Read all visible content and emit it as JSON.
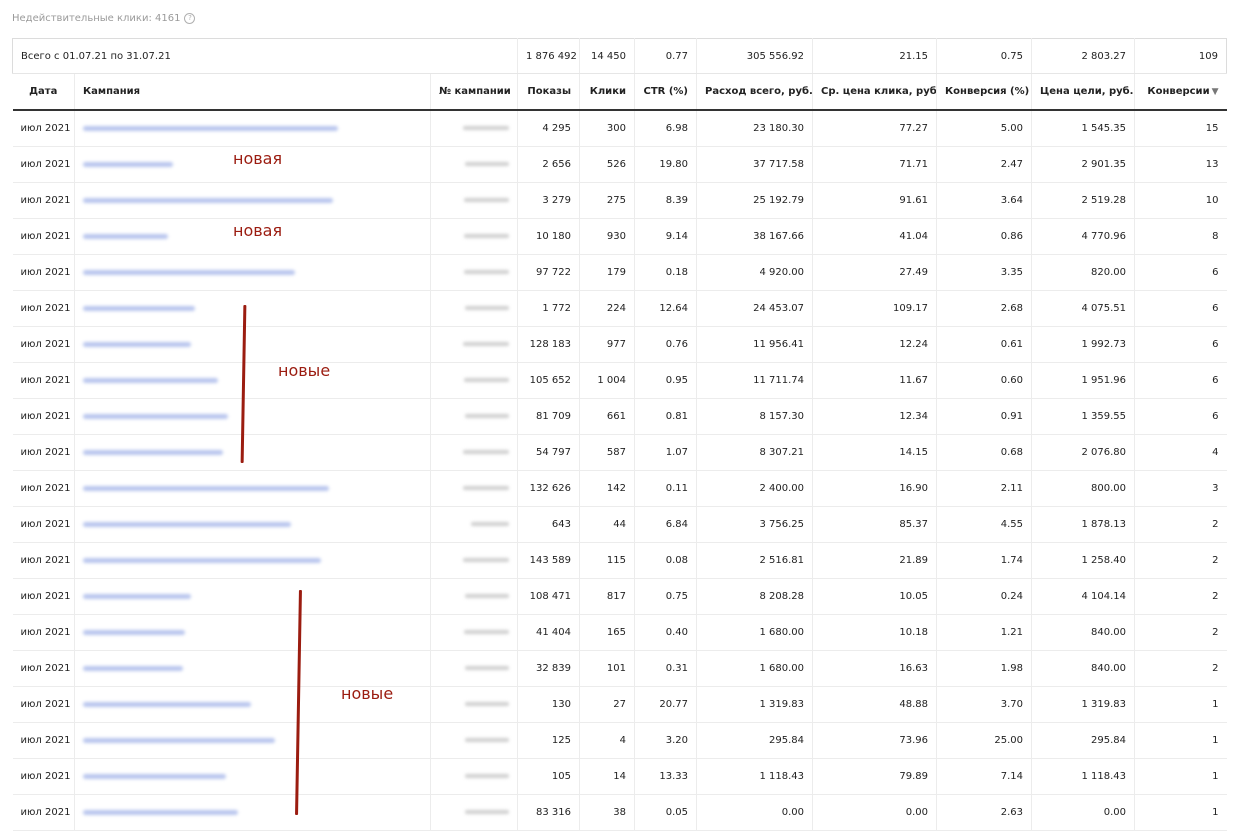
{
  "header": {
    "invalid_clicks": "Недействительные клики: 4161",
    "help_glyph": "?"
  },
  "totals": {
    "period": "Всего с 01.07.21 по 31.07.21",
    "impressions": "1 876 492",
    "clicks": "14 450",
    "ctr": "0.77",
    "spend": "305 556.92",
    "avg_cpc": "21.15",
    "conv_rate": "0.75",
    "goal_cost": "2 803.27",
    "conversions": "109"
  },
  "columns": {
    "date": "Дата",
    "campaign": "Кампания",
    "campaign_no": "№ кампании",
    "impressions": "Показы",
    "clicks": "Клики",
    "ctr": "CTR (%)",
    "spend": "Расход всего, руб.",
    "avg_cpc": "Ср. цена клика, руб.",
    "conv_rate": "Конверсия (%)",
    "goal_cost": "Цена цели, руб.",
    "conversions": "Конверсии",
    "sort_glyph": "▼"
  },
  "rows": [
    {
      "date": "июл 2021",
      "imp": "4 295",
      "clk": "300",
      "ctr": "6.98",
      "spend": "23 180.30",
      "cpc": "77.27",
      "cr": "5.00",
      "goal": "1 545.35",
      "conv": "15"
    },
    {
      "date": "июл 2021",
      "imp": "2 656",
      "clk": "526",
      "ctr": "19.80",
      "spend": "37 717.58",
      "cpc": "71.71",
      "cr": "2.47",
      "goal": "2 901.35",
      "conv": "13"
    },
    {
      "date": "июл 2021",
      "imp": "3 279",
      "clk": "275",
      "ctr": "8.39",
      "spend": "25 192.79",
      "cpc": "91.61",
      "cr": "3.64",
      "goal": "2 519.28",
      "conv": "10"
    },
    {
      "date": "июл 2021",
      "imp": "10 180",
      "clk": "930",
      "ctr": "9.14",
      "spend": "38 167.66",
      "cpc": "41.04",
      "cr": "0.86",
      "goal": "4 770.96",
      "conv": "8"
    },
    {
      "date": "июл 2021",
      "imp": "97 722",
      "clk": "179",
      "ctr": "0.18",
      "spend": "4 920.00",
      "cpc": "27.49",
      "cr": "3.35",
      "goal": "820.00",
      "conv": "6"
    },
    {
      "date": "июл 2021",
      "imp": "1 772",
      "clk": "224",
      "ctr": "12.64",
      "spend": "24 453.07",
      "cpc": "109.17",
      "cr": "2.68",
      "goal": "4 075.51",
      "conv": "6"
    },
    {
      "date": "июл 2021",
      "imp": "128 183",
      "clk": "977",
      "ctr": "0.76",
      "spend": "11 956.41",
      "cpc": "12.24",
      "cr": "0.61",
      "goal": "1 992.73",
      "conv": "6"
    },
    {
      "date": "июл 2021",
      "imp": "105 652",
      "clk": "1 004",
      "ctr": "0.95",
      "spend": "11 711.74",
      "cpc": "11.67",
      "cr": "0.60",
      "goal": "1 951.96",
      "conv": "6"
    },
    {
      "date": "июл 2021",
      "imp": "81 709",
      "clk": "661",
      "ctr": "0.81",
      "spend": "8 157.30",
      "cpc": "12.34",
      "cr": "0.91",
      "goal": "1 359.55",
      "conv": "6"
    },
    {
      "date": "июл 2021",
      "imp": "54 797",
      "clk": "587",
      "ctr": "1.07",
      "spend": "8 307.21",
      "cpc": "14.15",
      "cr": "0.68",
      "goal": "2 076.80",
      "conv": "4"
    },
    {
      "date": "июл 2021",
      "imp": "132 626",
      "clk": "142",
      "ctr": "0.11",
      "spend": "2 400.00",
      "cpc": "16.90",
      "cr": "2.11",
      "goal": "800.00",
      "conv": "3"
    },
    {
      "date": "июл 2021",
      "imp": "643",
      "clk": "44",
      "ctr": "6.84",
      "spend": "3 756.25",
      "cpc": "85.37",
      "cr": "4.55",
      "goal": "1 878.13",
      "conv": "2"
    },
    {
      "date": "июл 2021",
      "imp": "143 589",
      "clk": "115",
      "ctr": "0.08",
      "spend": "2 516.81",
      "cpc": "21.89",
      "cr": "1.74",
      "goal": "1 258.40",
      "conv": "2"
    },
    {
      "date": "июл 2021",
      "imp": "108 471",
      "clk": "817",
      "ctr": "0.75",
      "spend": "8 208.28",
      "cpc": "10.05",
      "cr": "0.24",
      "goal": "4 104.14",
      "conv": "2"
    },
    {
      "date": "июл 2021",
      "imp": "41 404",
      "clk": "165",
      "ctr": "0.40",
      "spend": "1 680.00",
      "cpc": "10.18",
      "cr": "1.21",
      "goal": "840.00",
      "conv": "2"
    },
    {
      "date": "июл 2021",
      "imp": "32 839",
      "clk": "101",
      "ctr": "0.31",
      "spend": "1 680.00",
      "cpc": "16.63",
      "cr": "1.98",
      "goal": "840.00",
      "conv": "2"
    },
    {
      "date": "июл 2021",
      "imp": "130",
      "clk": "27",
      "ctr": "20.77",
      "spend": "1 319.83",
      "cpc": "48.88",
      "cr": "3.70",
      "goal": "1 319.83",
      "conv": "1"
    },
    {
      "date": "июл 2021",
      "imp": "125",
      "clk": "4",
      "ctr": "3.20",
      "spend": "295.84",
      "cpc": "73.96",
      "cr": "25.00",
      "goal": "295.84",
      "conv": "1"
    },
    {
      "date": "июл 2021",
      "imp": "105",
      "clk": "14",
      "ctr": "13.33",
      "spend": "1 118.43",
      "cpc": "79.89",
      "cr": "7.14",
      "goal": "1 118.43",
      "conv": "1"
    },
    {
      "date": "июл 2021",
      "imp": "83 316",
      "clk": "38",
      "ctr": "0.05",
      "spend": "0.00",
      "cpc": "0.00",
      "cr": "2.63",
      "goal": "0.00",
      "conv": "1"
    }
  ],
  "annotations": {
    "new_single_1": "новая",
    "new_single_2": "новая",
    "new_group_1": "новые",
    "new_group_2": "новые",
    "color": "#9b1c10"
  },
  "colors": {
    "link_blur": "#b9c6ee",
    "header_border": "#333333"
  }
}
